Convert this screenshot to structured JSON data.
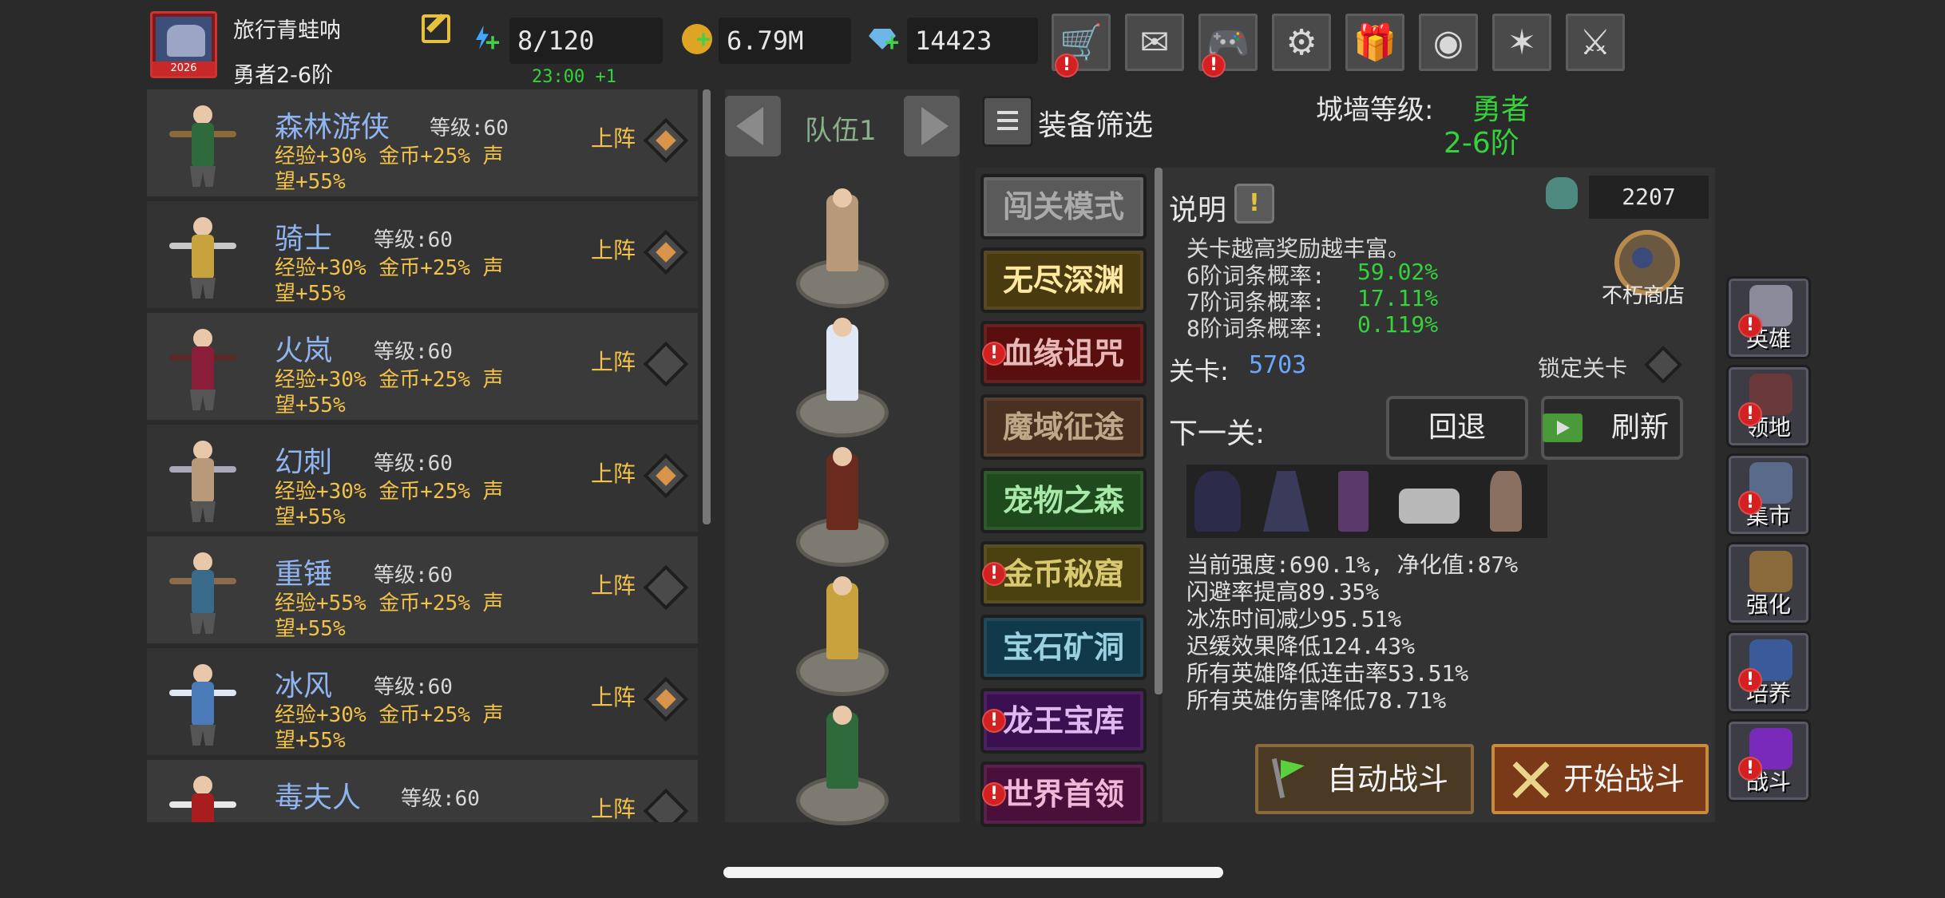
{
  "player": {
    "name": "旅行青蛙呐",
    "rank": "勇者2-6阶",
    "avatar_badge": "2026"
  },
  "resources": {
    "energy": "8/120",
    "timer": "23:00 +1",
    "gold": "6.79M",
    "gems": "14423"
  },
  "toolbar": [
    {
      "icon": "cart-icon",
      "glyph": "🛒",
      "alert": true
    },
    {
      "icon": "mail-icon",
      "glyph": "✉",
      "alert": false
    },
    {
      "icon": "gamepad-icon",
      "glyph": "🎮",
      "alert": true
    },
    {
      "icon": "gear-icon",
      "glyph": "⚙",
      "alert": false
    },
    {
      "icon": "gift-icon",
      "glyph": "🎁",
      "alert": false
    },
    {
      "icon": "color-wheel-icon",
      "glyph": "◉",
      "alert": false
    },
    {
      "icon": "firework-icon",
      "glyph": "✶",
      "alert": false
    },
    {
      "icon": "crossed-swords-icon",
      "glyph": "⚔",
      "alert": false
    }
  ],
  "heroes": {
    "level_prefix": "等级:",
    "deploy_label": "上阵",
    "list": [
      {
        "name": "森林游侠",
        "level": "60",
        "bonus_exp": "经验+30%",
        "bonus_gold": "金币+25%",
        "bonus_fame_a": "声",
        "bonus_fame_b": "望+55%",
        "selected": true
      },
      {
        "name": "骑士",
        "level": "60",
        "bonus_exp": "经验+30%",
        "bonus_gold": "金币+25%",
        "bonus_fame_a": "声",
        "bonus_fame_b": "望+55%",
        "selected": true
      },
      {
        "name": "火岚",
        "level": "60",
        "bonus_exp": "经验+30%",
        "bonus_gold": "金币+25%",
        "bonus_fame_a": "声",
        "bonus_fame_b": "望+55%",
        "selected": false
      },
      {
        "name": "幻刺",
        "level": "60",
        "bonus_exp": "经验+30%",
        "bonus_gold": "金币+25%",
        "bonus_fame_a": "声",
        "bonus_fame_b": "望+55%",
        "selected": true
      },
      {
        "name": "重锤",
        "level": "60",
        "bonus_exp": "经验+55%",
        "bonus_gold": "金币+25%",
        "bonus_fame_a": "声",
        "bonus_fame_b": "望+55%",
        "selected": false
      },
      {
        "name": "冰风",
        "level": "60",
        "bonus_exp": "经验+30%",
        "bonus_gold": "金币+25%",
        "bonus_fame_a": "声",
        "bonus_fame_b": "望+55%",
        "selected": true
      },
      {
        "name": "毒夫人",
        "level": "60",
        "bonus_exp": "",
        "bonus_gold": "",
        "bonus_fame_a": "",
        "bonus_fame_b": "",
        "selected": false
      }
    ]
  },
  "team": {
    "label": "队伍1"
  },
  "filter": {
    "label": "装备筛选"
  },
  "wall": {
    "label": "城墙等级:",
    "value_line1": "勇者",
    "value_line2": "2-6阶"
  },
  "modes": [
    {
      "label": "闯关模式",
      "alert": false
    },
    {
      "label": "无尽深渊",
      "alert": false
    },
    {
      "label": "血缘诅咒",
      "alert": true
    },
    {
      "label": "魔域征途",
      "alert": false
    },
    {
      "label": "宠物之森",
      "alert": false
    },
    {
      "label": "金币秘窟",
      "alert": true
    },
    {
      "label": "宝石矿洞",
      "alert": false
    },
    {
      "label": "龙王宝库",
      "alert": true
    },
    {
      "label": "世界首领",
      "alert": true
    }
  ],
  "info": {
    "title": "说明",
    "info_button": "!",
    "desc": "关卡越高奖励越丰富。",
    "probabilities": [
      {
        "label": "6阶词条概率:",
        "value": "59.02%"
      },
      {
        "label": "7阶词条概率:",
        "value": "17.11%"
      },
      {
        "label": "8阶词条概率:",
        "value": "0.119%"
      }
    ],
    "pet_count": "2207",
    "shop_label": "不朽商店",
    "stage_label": "关卡:",
    "stage_value": "5703",
    "lock_label": "锁定关卡",
    "next_label": "下一关:",
    "back_button": "回退",
    "refresh_button": "刷新",
    "stats": [
      "当前强度:690.1%, 净化值:87%",
      "闪避率提高89.35%",
      "冰冻时间减少95.51%",
      "迟缓效果降低124.43%",
      "所有英雄降低连击率53.51%",
      "所有英雄伤害降低78.71%"
    ],
    "auto_battle": "自动战斗",
    "start_battle": "开始战斗"
  },
  "side_nav": [
    {
      "label": "英雄",
      "icon": "helmet-icon",
      "alert": true
    },
    {
      "label": "领地",
      "icon": "castle-icon",
      "alert": true
    },
    {
      "label": "集市",
      "icon": "market-icon",
      "alert": true
    },
    {
      "label": "强化",
      "icon": "crystal-icon",
      "alert": false
    },
    {
      "label": "培养",
      "icon": "chalice-icon",
      "alert": true
    },
    {
      "label": "战斗",
      "icon": "portal-icon",
      "alert": true
    }
  ]
}
